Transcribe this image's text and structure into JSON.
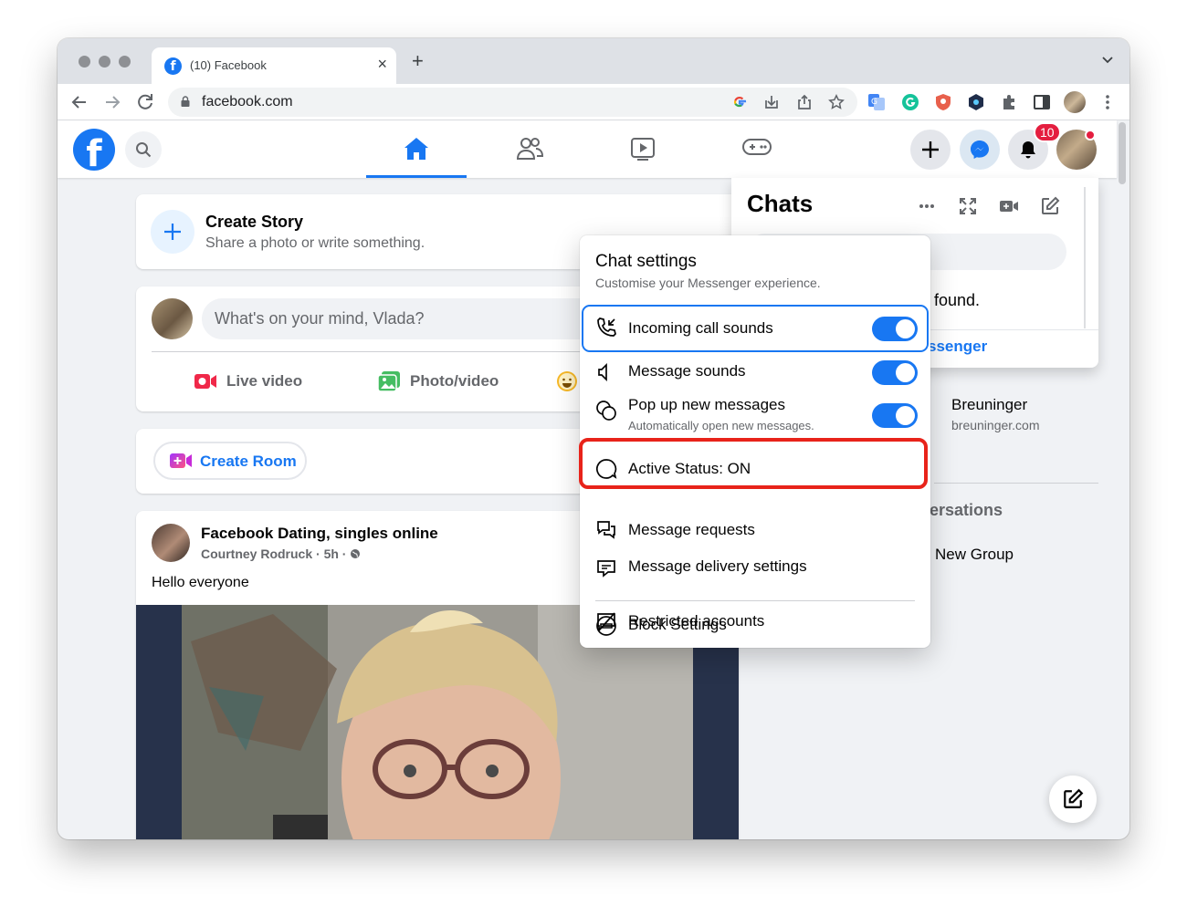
{
  "browser": {
    "tab_title": "(10) Facebook",
    "url": "facebook.com"
  },
  "topbar": {
    "notification_count": "10",
    "nav_tabs": [
      "home-icon",
      "friends-icon",
      "watch-icon",
      "gaming-icon"
    ],
    "active_tab": "home",
    "accent_color": "#1877f2"
  },
  "story": {
    "title": "Create Story",
    "subtitle": "Share a photo or write something."
  },
  "composer": {
    "placeholder": "What's on your mind, Vlada?",
    "live_video": "Live video",
    "photo_video": "Photo/video"
  },
  "room": {
    "label": "Create Room"
  },
  "post": {
    "title": "Facebook Dating, singles online",
    "author": "Courtney Rodruck",
    "time": "5h",
    "text": "Hello everyone"
  },
  "chats": {
    "title": "Chats",
    "found_text": "found.",
    "messenger_link": "ssenger",
    "contact_name": "Breuninger",
    "contact_sub": "breuninger.com",
    "section_heading": "ersations",
    "new_group": "New Group"
  },
  "chat_settings": {
    "title": "Chat settings",
    "subtitle": "Customise your Messenger experience.",
    "items": [
      {
        "label": "Incoming call sounds",
        "icon": "phone-incoming-icon",
        "toggle": "on"
      },
      {
        "label": "Message sounds",
        "icon": "speaker-icon",
        "toggle": "on"
      },
      {
        "label": "Pop up new messages",
        "sub": "Automatically open new messages.",
        "icon": "popup-messages-icon",
        "toggle": "on"
      },
      {
        "label": "Active Status: ON",
        "icon": "active-status-icon"
      },
      {
        "label": "Message requests",
        "icon": "message-requests-icon"
      },
      {
        "label": "Message delivery settings",
        "icon": "message-delivery-icon"
      },
      {
        "label": "Restricted accounts",
        "icon": "restricted-icon"
      },
      {
        "label": "Block Settings",
        "icon": "block-icon"
      }
    ]
  }
}
